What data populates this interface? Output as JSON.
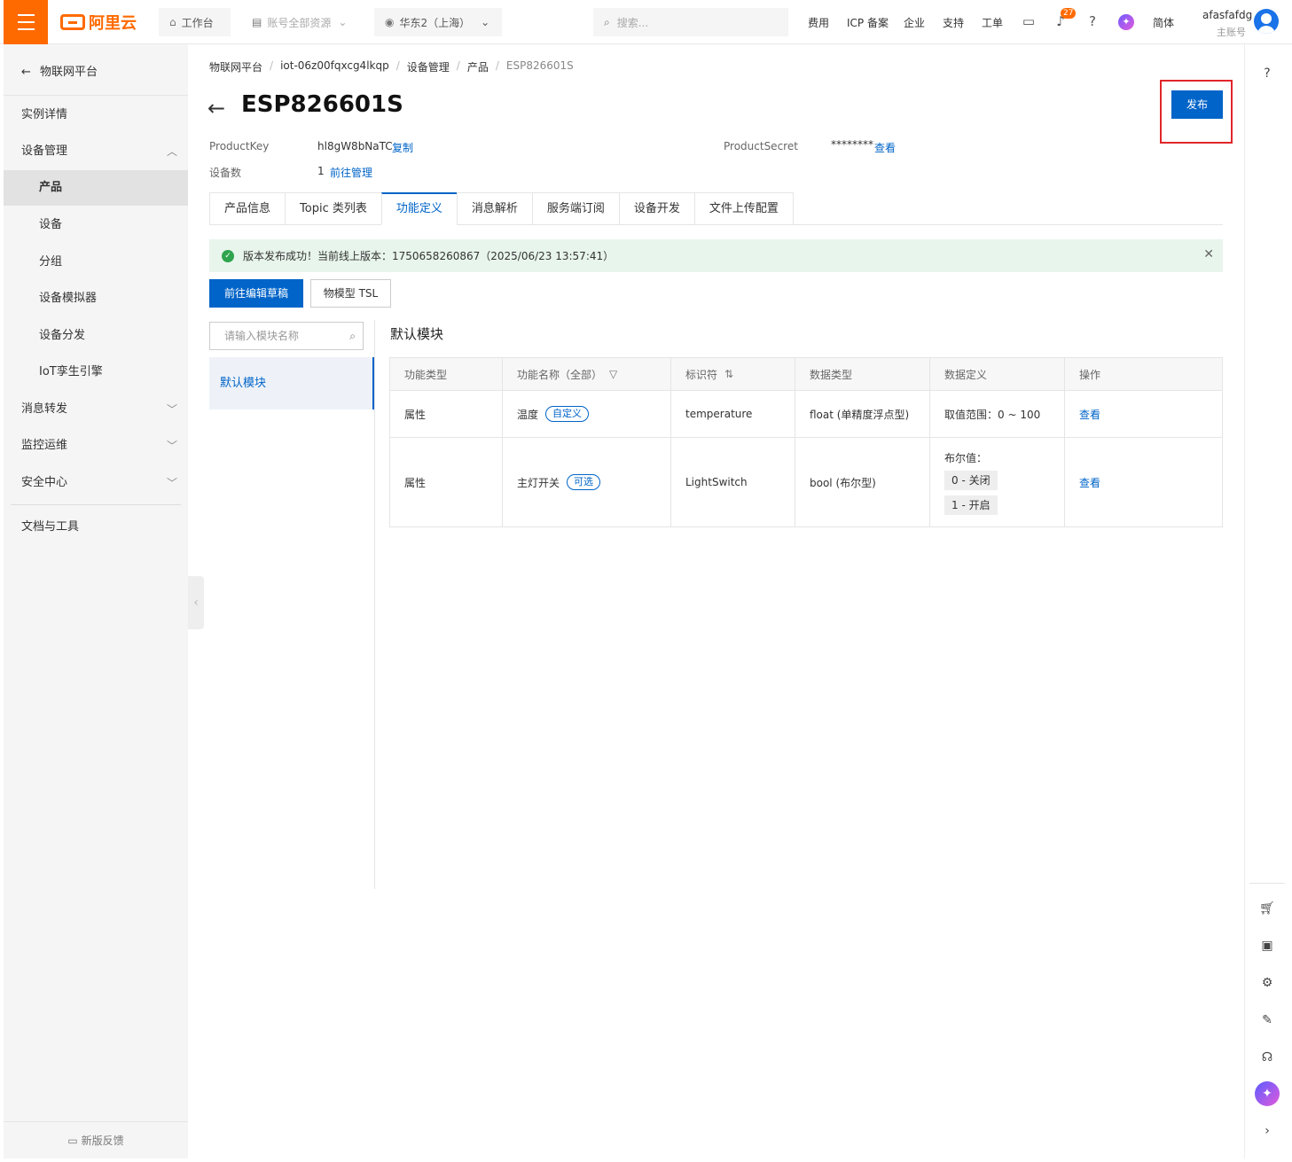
{
  "topbar": {
    "logo": "阿里云",
    "workbench": "工作台",
    "account_resources": "账号全部资源",
    "region": "华东2（上海）",
    "search_placeholder": "搜索...",
    "links": [
      "费用",
      "ICP 备案",
      "企业",
      "支持",
      "工单"
    ],
    "notification_count": "27",
    "lang": "简体",
    "user_name": "afasfafdg",
    "user_role": "主账号"
  },
  "sidebar": {
    "back_label": "物联网平台",
    "items": [
      {
        "label": "实例详情"
      },
      {
        "label": "设备管理"
      },
      {
        "label": "产品"
      },
      {
        "label": "设备"
      },
      {
        "label": "分组"
      },
      {
        "label": "设备模拟器"
      },
      {
        "label": "设备分发"
      },
      {
        "label": "IoT孪生引擎"
      },
      {
        "label": "消息转发"
      },
      {
        "label": "监控运维"
      },
      {
        "label": "安全中心"
      },
      {
        "label": "文档与工具"
      }
    ],
    "feedback": "新版反馈"
  },
  "breadcrumb": [
    "物联网平台",
    "iot-06z00fqxcg4lkqp",
    "设备管理",
    "产品",
    "ESP826601S"
  ],
  "page": {
    "title": "ESP826601S",
    "publish_label": "发布",
    "product_key_label": "ProductKey",
    "product_key_value": "hl8gW8bNaTC",
    "copy_label": "复制",
    "product_secret_label": "ProductSecret",
    "product_secret_value": "********",
    "view_label": "查看",
    "device_count_label": "设备数",
    "device_count_value": "1",
    "manage_label": "前往管理"
  },
  "tabs": [
    "产品信息",
    "Topic 类列表",
    "功能定义",
    "消息解析",
    "服务端订阅",
    "设备开发",
    "文件上传配置"
  ],
  "active_tab": "功能定义",
  "alert": {
    "text": "版本发布成功！当前线上版本：1750658260867（2025/06/23 13:57:41）"
  },
  "actions": {
    "edit_draft": "前往编辑草稿",
    "tsl": "物模型 TSL"
  },
  "modules": {
    "search_placeholder": "请输入模块名称",
    "items": [
      "默认模块"
    ],
    "section_title": "默认模块"
  },
  "table": {
    "headers": [
      "功能类型",
      "功能名称（全部）",
      "标识符",
      "数据类型",
      "数据定义",
      "操作"
    ],
    "rows": [
      {
        "type": "属性",
        "name": "温度",
        "tag": "自定义",
        "identifier": "temperature",
        "data_type": "float (单精度浮点型)",
        "definition": "取值范围：0 ~ 100",
        "action": "查看"
      },
      {
        "type": "属性",
        "name": "主灯开关",
        "tag": "可选",
        "identifier": "LightSwitch",
        "data_type": "bool (布尔型)",
        "definition_title": "布尔值：",
        "bool_values": [
          "0 - 关闭",
          "1 - 开启"
        ],
        "action": "查看"
      }
    ]
  },
  "colors": {
    "brand_orange": "#ff6a00",
    "primary_blue": "#0064c8",
    "success_bg": "#e8f5ec",
    "highlight_red": "#e0262a"
  }
}
